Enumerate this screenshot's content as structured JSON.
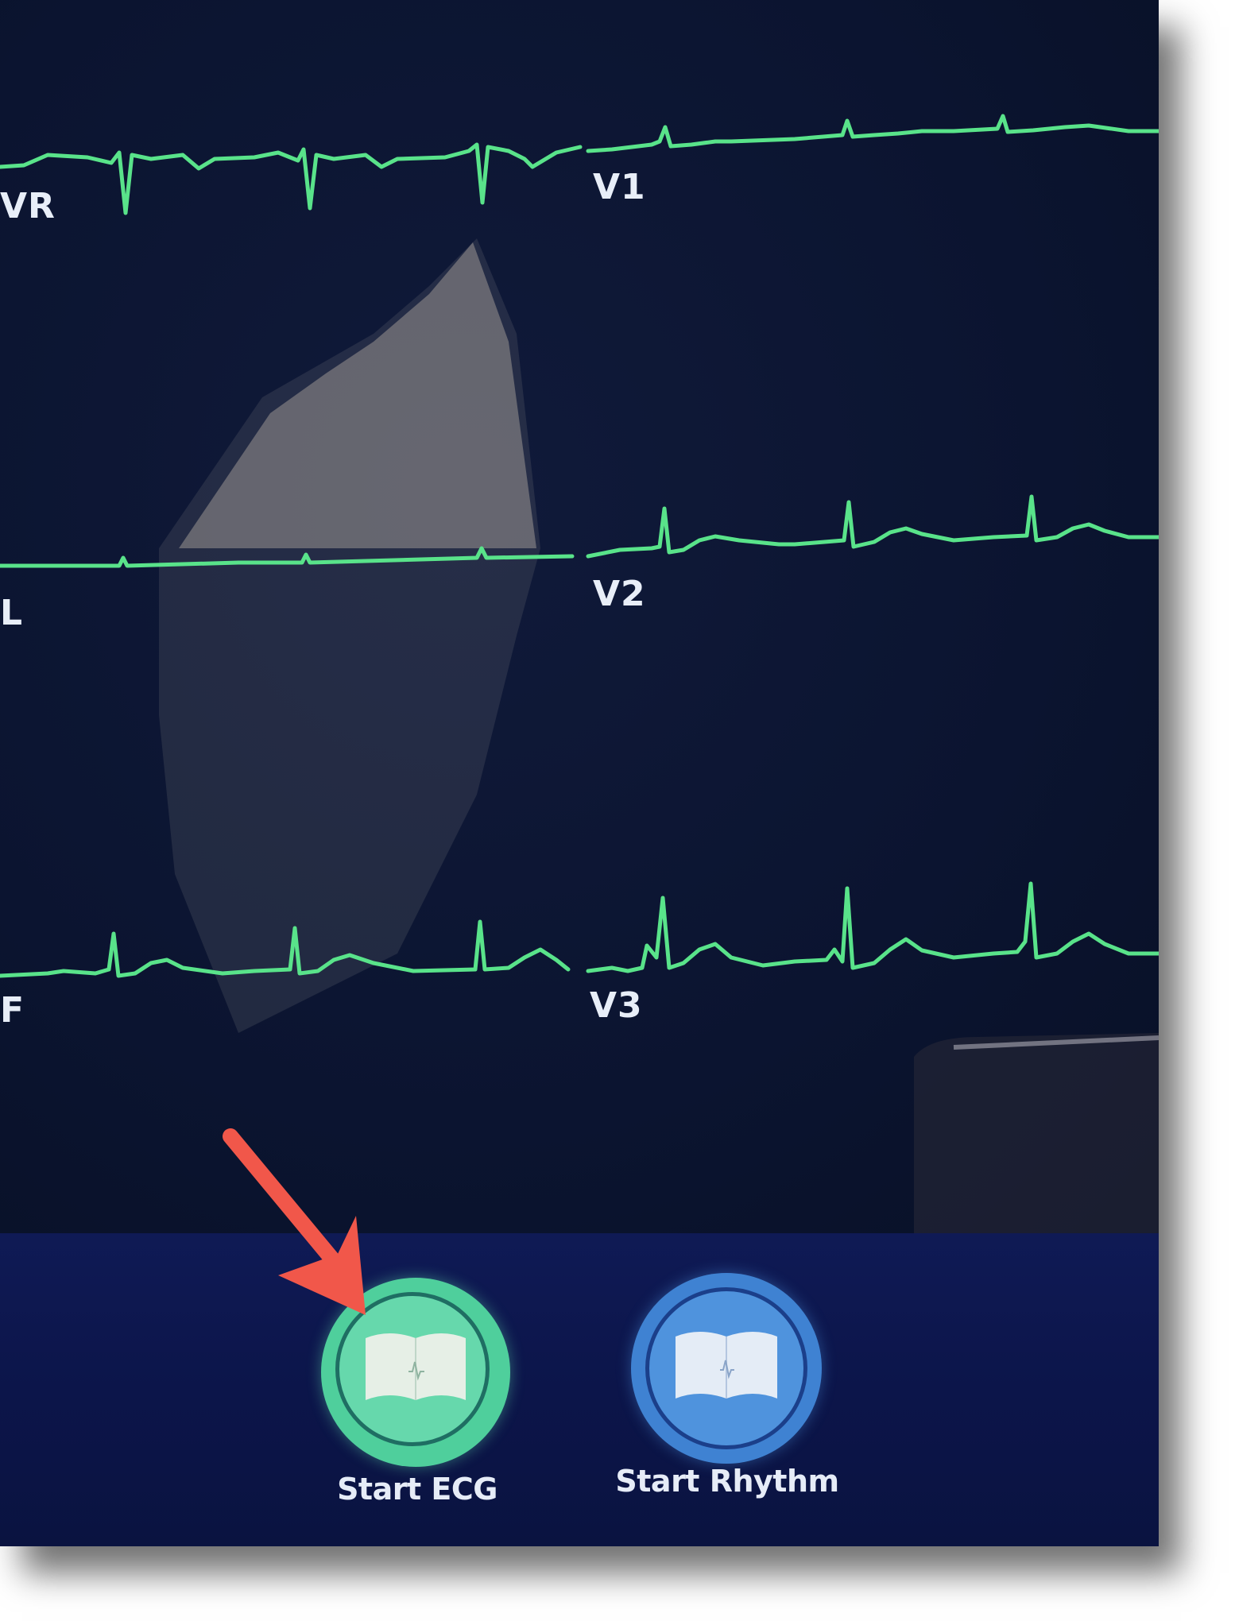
{
  "leads": {
    "avr": "VR",
    "avl": "L",
    "avf": "F",
    "v1": "V1",
    "v2": "V2",
    "v3": "V3"
  },
  "actions": {
    "start_ecg": "Start ECG",
    "start_rhythm": "Start Rhythm"
  },
  "icons": {
    "start_ecg": "ecg-book-icon",
    "start_rhythm": "rhythm-book-icon",
    "pointer": "red-arrow-icon"
  },
  "colors": {
    "trace": "#59e38a",
    "background": "#0a1229",
    "toolbar": "#0d1650",
    "ecg_button": "#5ed3a8",
    "rhythm_button": "#4a8fd9",
    "arrow": "#f1574a"
  }
}
